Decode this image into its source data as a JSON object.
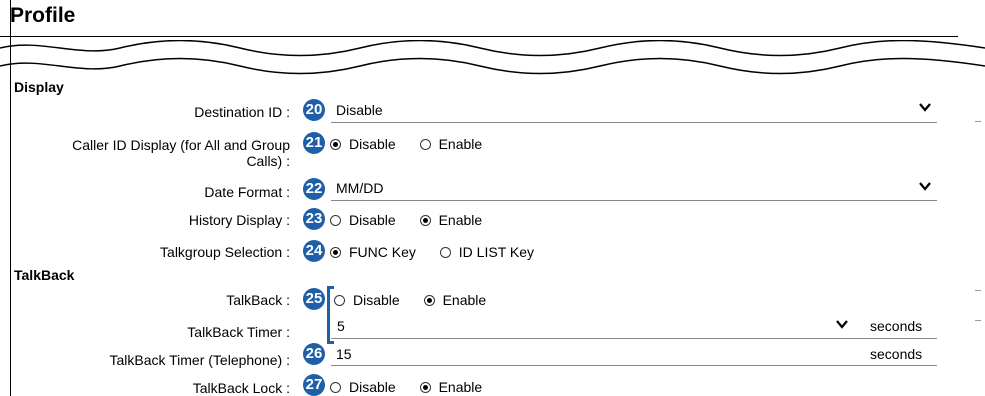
{
  "page": {
    "title": "Profile"
  },
  "sections": {
    "display": "Display",
    "talkback": "TalkBack"
  },
  "rows": {
    "destination_id": {
      "label": "Destination ID :",
      "badge": "20",
      "value": "Disable"
    },
    "caller_id": {
      "label_line1": "Caller ID Display (for All and Group",
      "label_line2": "Calls) :",
      "badge": "21",
      "options": [
        "Disable",
        "Enable"
      ],
      "selected": "Disable"
    },
    "date_format": {
      "label": "Date Format :",
      "badge": "22",
      "value": "MM/DD"
    },
    "history_display": {
      "label": "History Display :",
      "badge": "23",
      "options": [
        "Disable",
        "Enable"
      ],
      "selected": "Enable"
    },
    "talkgroup_selection": {
      "label": "Talkgroup Selection :",
      "badge": "24",
      "options": [
        "FUNC Key",
        "ID LIST Key"
      ],
      "selected": "FUNC Key"
    },
    "talkback": {
      "label": "TalkBack :",
      "badge": "25",
      "options": [
        "Disable",
        "Enable"
      ],
      "selected": "Enable"
    },
    "talkback_timer": {
      "label": "TalkBack Timer :",
      "value": "5",
      "unit": "seconds"
    },
    "talkback_timer_tel": {
      "label": "TalkBack Timer (Telephone) :",
      "badge": "26",
      "value": "15",
      "unit": "seconds"
    },
    "talkback_lock": {
      "label": "TalkBack Lock :",
      "badge": "27",
      "options": [
        "Disable",
        "Enable"
      ],
      "selected": "Enable"
    }
  },
  "icons": {
    "chevron": "chevron-down-icon",
    "accent_color": "#1f5fa8"
  }
}
